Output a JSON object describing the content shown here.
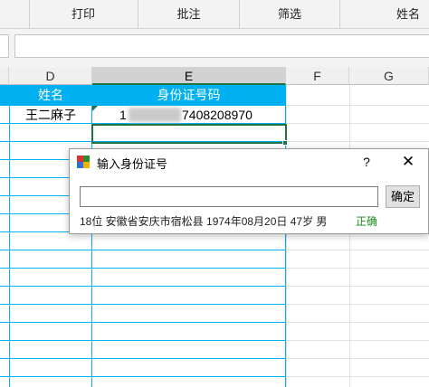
{
  "ribbon": {
    "print_label": "打印",
    "comment_label": "批注",
    "filter_label": "筛选",
    "name_label": "姓名"
  },
  "columns": [
    "D",
    "E",
    "F",
    "G"
  ],
  "table": {
    "header_name": "姓名",
    "header_id": "身份证号码",
    "row1_name": "王二麻子",
    "row1_id_prefix": "1",
    "row1_id_suffix": "7408208970"
  },
  "dialog": {
    "title": "输入身份证号",
    "help_label": "?",
    "close_label": "✕",
    "input_value": "",
    "ok_label": "确定",
    "info_text": "18位  安徽省安庆市宿松县  1974年08月20日  47岁  男",
    "status_text": "正确"
  },
  "colors": {
    "header_fill": "#00b0f0",
    "gridline_accent": "#00b0f0",
    "status_green": "#1e8a1e",
    "selection": "#217346"
  }
}
